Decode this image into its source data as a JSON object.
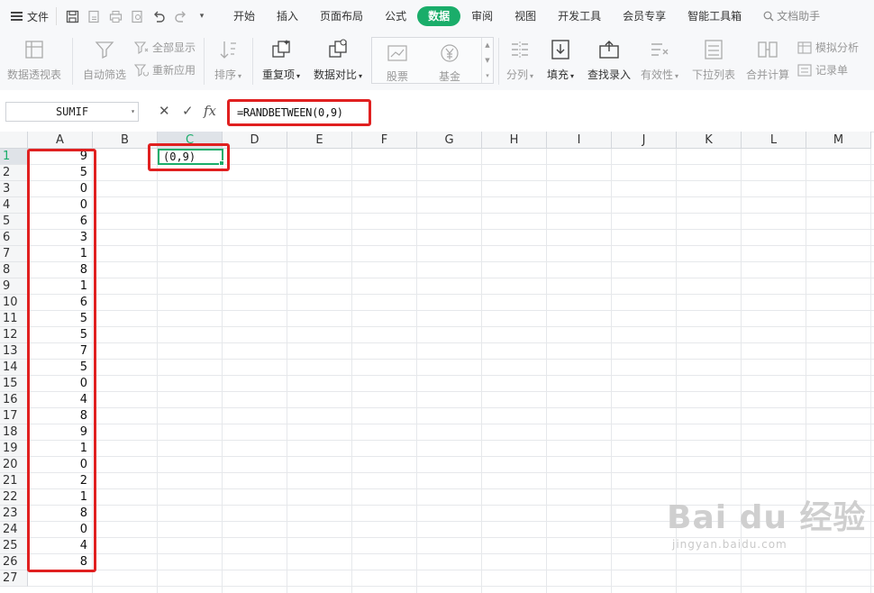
{
  "menubar": {
    "file_label": "文件",
    "tabs": [
      "开始",
      "插入",
      "页面布局",
      "公式",
      "数据",
      "审阅",
      "视图",
      "开发工具",
      "会员专享",
      "智能工具箱"
    ],
    "active_tab": "数据",
    "search_label": "文档助手"
  },
  "ribbon": {
    "pivot_table": "数据透视表",
    "auto_filter": "自动筛选",
    "show_all": "全部显示",
    "reapply": "重新应用",
    "sort": "排序",
    "duplicates": "重复项",
    "compare": "数据对比",
    "stock": "股票",
    "fund": "基金",
    "split": "分列",
    "fill": "填充",
    "find_entry": "查找录入",
    "validity": "有效性",
    "dropdown_list": "下拉列表",
    "consolidate": "合并计算",
    "what_if": "模拟分析",
    "record_form": "记录单"
  },
  "formula_bar": {
    "name_box": "SUMIF",
    "formula": "=RANDBETWEEN(0,9)",
    "cancel_glyph": "✕",
    "confirm_glyph": "✓",
    "fx_glyph": "fx"
  },
  "sheet": {
    "columns": [
      "A",
      "B",
      "C",
      "D",
      "E",
      "F",
      "G",
      "H",
      "I",
      "J",
      "K",
      "L",
      "M"
    ],
    "selected_column": "C",
    "rows": [
      "1",
      "2",
      "3",
      "4",
      "5",
      "6",
      "7",
      "8",
      "9",
      "10",
      "11",
      "12",
      "13",
      "14",
      "15",
      "16",
      "17",
      "18",
      "19",
      "20",
      "21",
      "22",
      "23",
      "24",
      "25",
      "26",
      "27"
    ],
    "column_a_values": [
      "9",
      "5",
      "0",
      "0",
      "6",
      "3",
      "1",
      "8",
      "1",
      "6",
      "5",
      "5",
      "7",
      "5",
      "0",
      "4",
      "8",
      "9",
      "1",
      "0",
      "2",
      "1",
      "8",
      "0",
      "4",
      "8"
    ],
    "active_cell_text": "(0,9)"
  },
  "watermark": {
    "main": "Bai du 经验",
    "sub": "jingyan.baidu.com"
  },
  "colors": {
    "accent_green": "#1aad6a",
    "highlight_red": "#e02020"
  }
}
